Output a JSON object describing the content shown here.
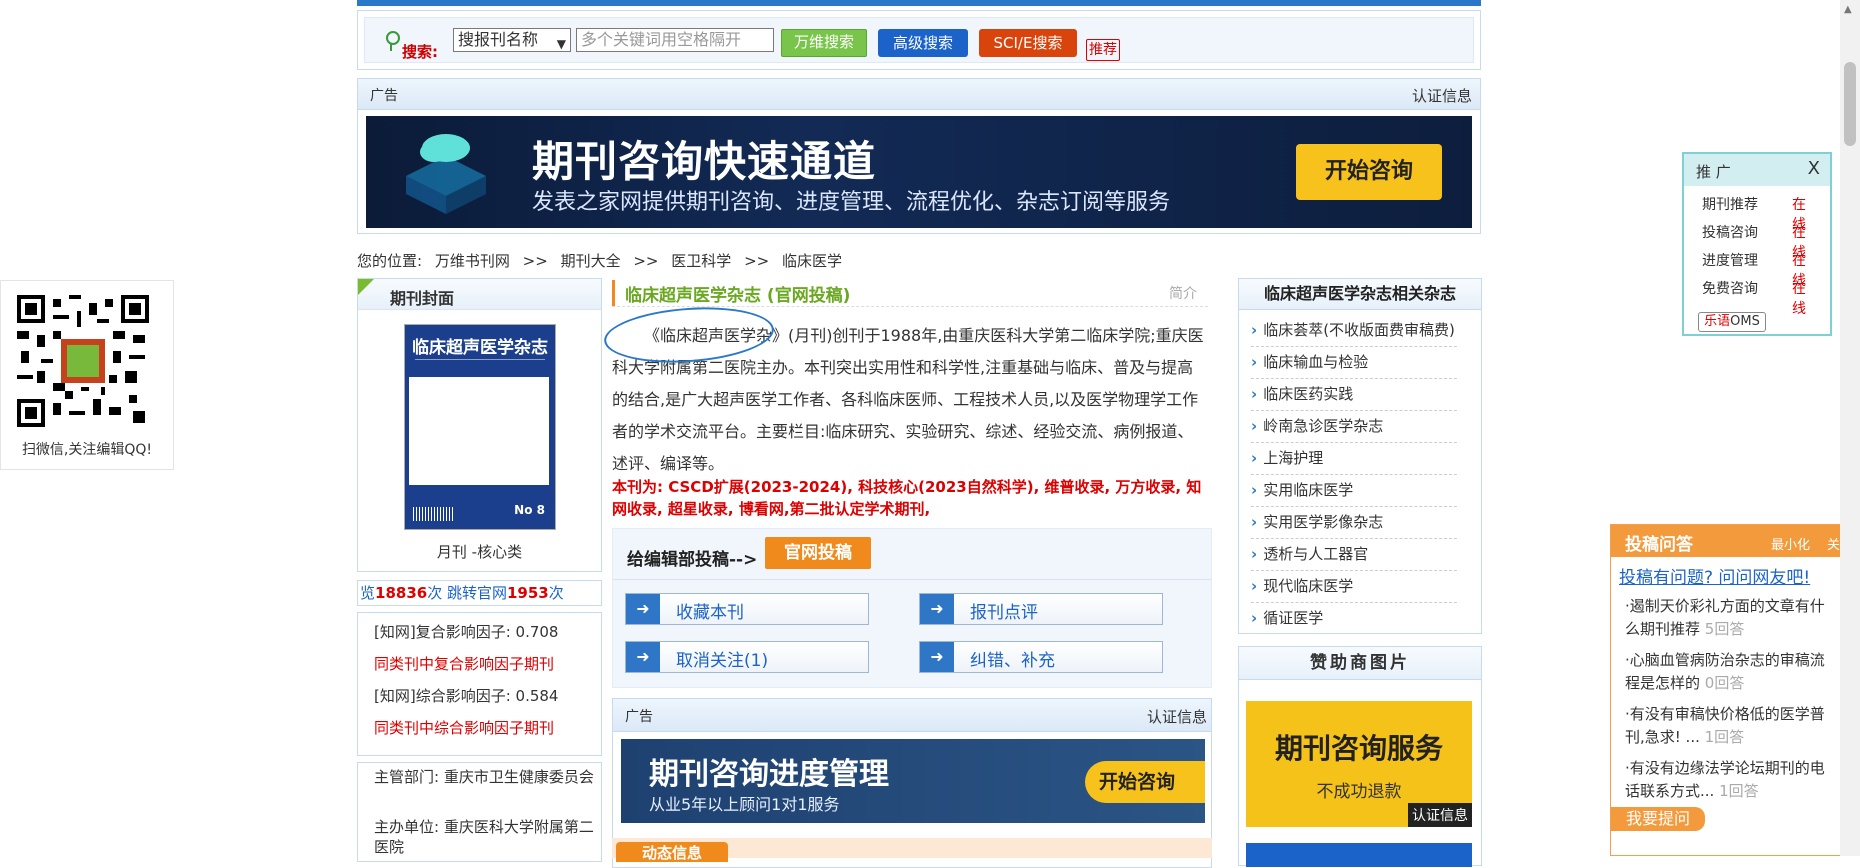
{
  "search": {
    "label": "搜索:",
    "select_value": "搜报刊名称",
    "placeholder": "多个关键词用空格隔开",
    "btn_wanfang": "万维搜索",
    "btn_advanced": "高级搜索",
    "btn_sci": "SCI/E搜索",
    "btn_recommend": "推荐"
  },
  "top_ad": {
    "label": "广告",
    "cert": "认证信息",
    "title": "期刊咨询快速通道",
    "subtitle": "发表之家网提供期刊咨询、进度管理、流程优化、杂志订阅等服务",
    "cta": "开始咨询"
  },
  "breadcrumb": {
    "prefix": "您的位置:",
    "items": [
      "万维书刊网",
      ">>",
      "期刊大全",
      ">>",
      "医卫科学",
      ">>",
      "临床医学"
    ]
  },
  "left": {
    "cover_title": "期刊封面",
    "cover_journal": "临床超声医学杂志",
    "cover_issue": "No 8",
    "cover_caption": "月刊 -核心类",
    "visits_prefix": "览",
    "visits_count": "18836",
    "visits_mid": "次 跳转官网",
    "jump_count": "1953",
    "visits_suffix": "次",
    "impact": [
      {
        "text": "[知网]复合影响因子: 0.708",
        "red": false
      },
      {
        "text": "同类刊中复合影响因子期刊",
        "red": true
      },
      {
        "text": "[知网]综合影响因子: 0.584",
        "red": false
      },
      {
        "text": "同类刊中综合影响因子期刊",
        "red": true
      }
    ],
    "org_supervisor": "主管部门: 重庆市卫生健康委员会",
    "org_host": "主办单位: 重庆医科大学附属第二医院"
  },
  "qr": {
    "caption": "扫微信,关注编辑QQ!"
  },
  "middle": {
    "title": "临床超声医学杂志 (官网投稿)",
    "intro_label": "简介",
    "intro": "《临床超声医学杂》(月刊)创刊于1988年,由重庆医科大学第二临床学院;重庆医科大学附属第二医院主办。本刊突出实用性和科学性,注重基础与临床、普及与提高的结合,是广大超声医学工作者、各科临床医师、工程技术人员,以及医学物理学工作者的学术交流平台。主要栏目:临床研究、实验研究、综述、经验交流、病例报道、述评、编译等。",
    "collections": "本刊为: CSCD扩展(2023-2024), 科技核心(2023自然科学), 维普收录, 万方收录, 知网收录, 超星收录, 博看网,第二批认定学术期刊,",
    "submit_label": "给编辑部投稿-->",
    "submit_button": "官网投稿",
    "actions": [
      "收藏本刊",
      "报刊点评",
      "取消关注(1)",
      "纠错、补充"
    ],
    "ad_label": "广告",
    "ad_cert": "认证信息",
    "ad_title": "期刊咨询进度管理",
    "ad_subtitle": "从业5年以上顾问1对1服务",
    "ad_cta": "开始咨询",
    "news_tab": "动态信息"
  },
  "right": {
    "related_title": "临床超声医学杂志相关杂志",
    "related": [
      "临床荟萃(不收版面费审稿费)",
      "临床输血与检验",
      "临床医药实践",
      "岭南急诊医学杂志",
      "上海护理",
      "实用临床医学",
      "实用医学影像杂志",
      "透析与人工器官",
      "现代临床医学",
      "循证医学"
    ],
    "sponsor_title": "赞助商图片",
    "sponsor_ad_title": "期刊咨询服务",
    "sponsor_ad_sub": "不成功退款",
    "sponsor_cert": "认证信息"
  },
  "promo": {
    "title": "推 广",
    "close": "X",
    "rows": [
      {
        "label": "期刊推荐",
        "status": "在线"
      },
      {
        "label": "投稿咨询",
        "status": "在线"
      },
      {
        "label": "进度管理",
        "status": "在线"
      },
      {
        "label": "免费咨询",
        "status": "在线"
      }
    ],
    "le_brand": "乐语",
    "le_suffix": "OMS"
  },
  "qa": {
    "title": "投稿问答",
    "minimize": "最小化",
    "close": "关",
    "ask_link": "投稿有问题? 问问网友吧!",
    "questions": [
      {
        "text": "·遏制天价彩礼方面的文章有什么期刊推荐",
        "answers": "5回答"
      },
      {
        "text": "·心脑血管病防治杂志的审稿流程是怎样的",
        "answers": "0回答"
      },
      {
        "text": "·有没有审稿快价格低的医学普刊,急求! ...",
        "answers": "1回答"
      },
      {
        "text": "·有没有边缘法学论坛期刊的电话联系方式...",
        "answers": "1回答"
      }
    ],
    "ask_button": "我要提问"
  }
}
